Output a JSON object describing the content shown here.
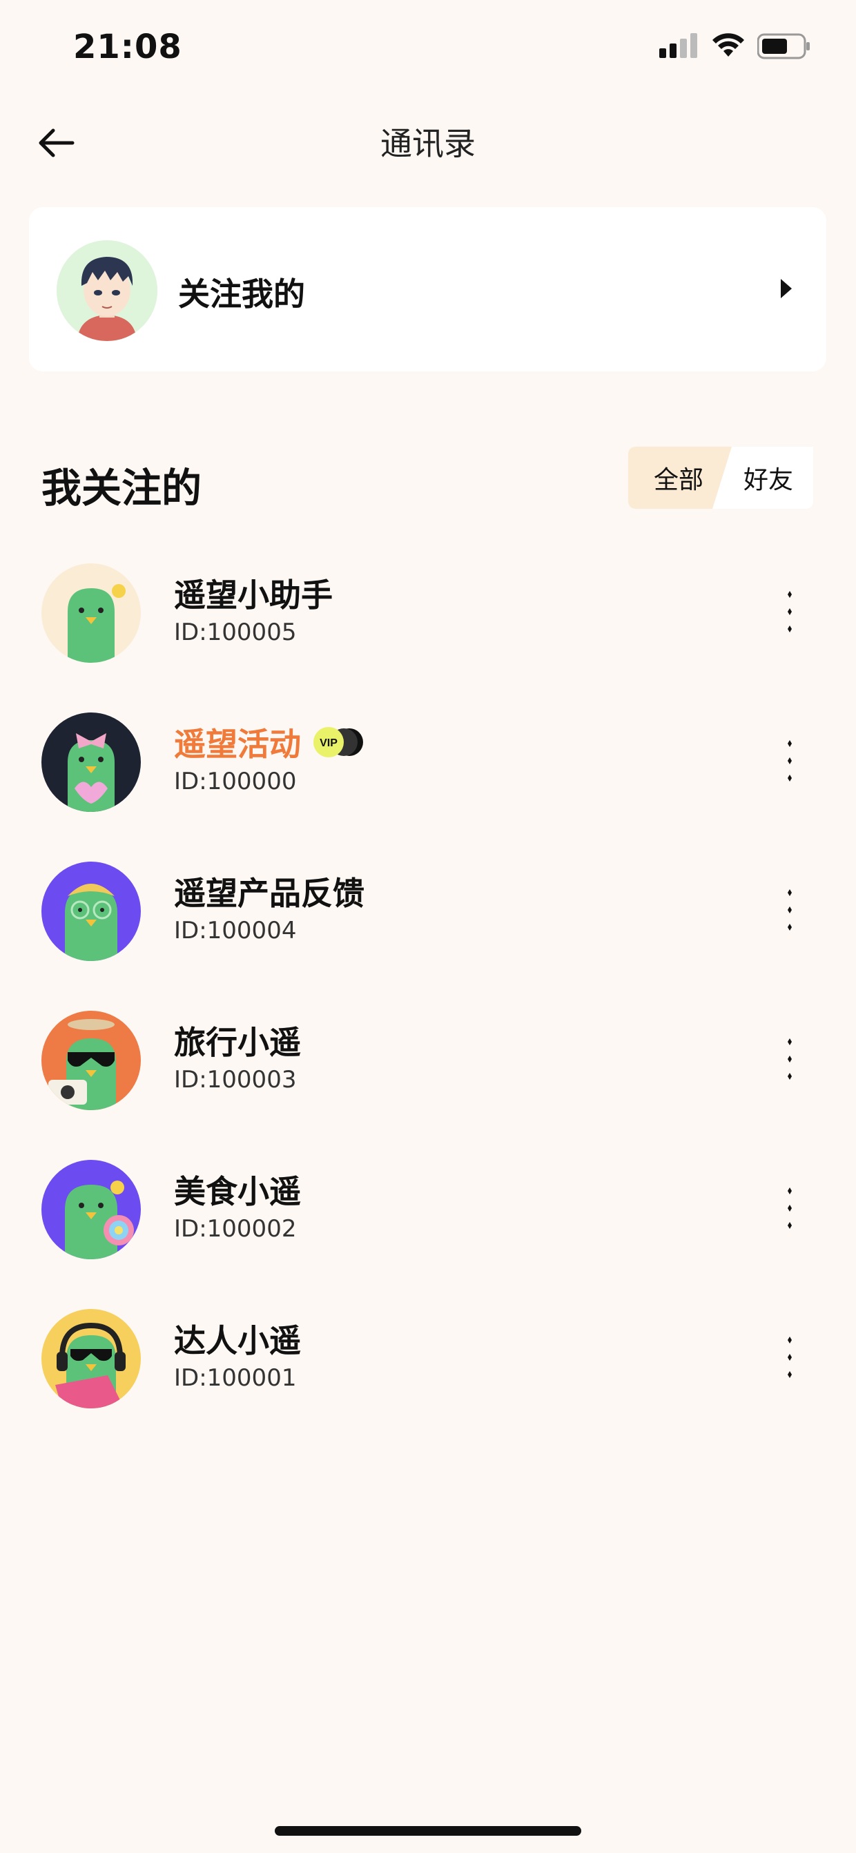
{
  "status_bar": {
    "time": "21:08"
  },
  "header": {
    "title": "通讯录"
  },
  "followers_card": {
    "label": "关注我的"
  },
  "following": {
    "title": "我关注的",
    "segments": {
      "all": "全部",
      "friends": "好友"
    },
    "items": [
      {
        "name": "遥望小助手",
        "id": "ID:100005",
        "color": "#111111"
      },
      {
        "name": "遥望活动",
        "id": "ID:100000",
        "color": "#f07a3a",
        "badge": "VIP"
      },
      {
        "name": "遥望产品反馈",
        "id": "ID:100004",
        "color": "#111111"
      },
      {
        "name": "旅行小遥",
        "id": "ID:100003",
        "color": "#111111"
      },
      {
        "name": "美食小遥",
        "id": "ID:100002",
        "color": "#111111"
      },
      {
        "name": "达人小遥",
        "id": "ID:100001",
        "color": "#111111"
      }
    ]
  },
  "colors": {
    "background": "#fdf8f3",
    "accent": "#f07a3a",
    "segment_active": "#fcebd4"
  }
}
